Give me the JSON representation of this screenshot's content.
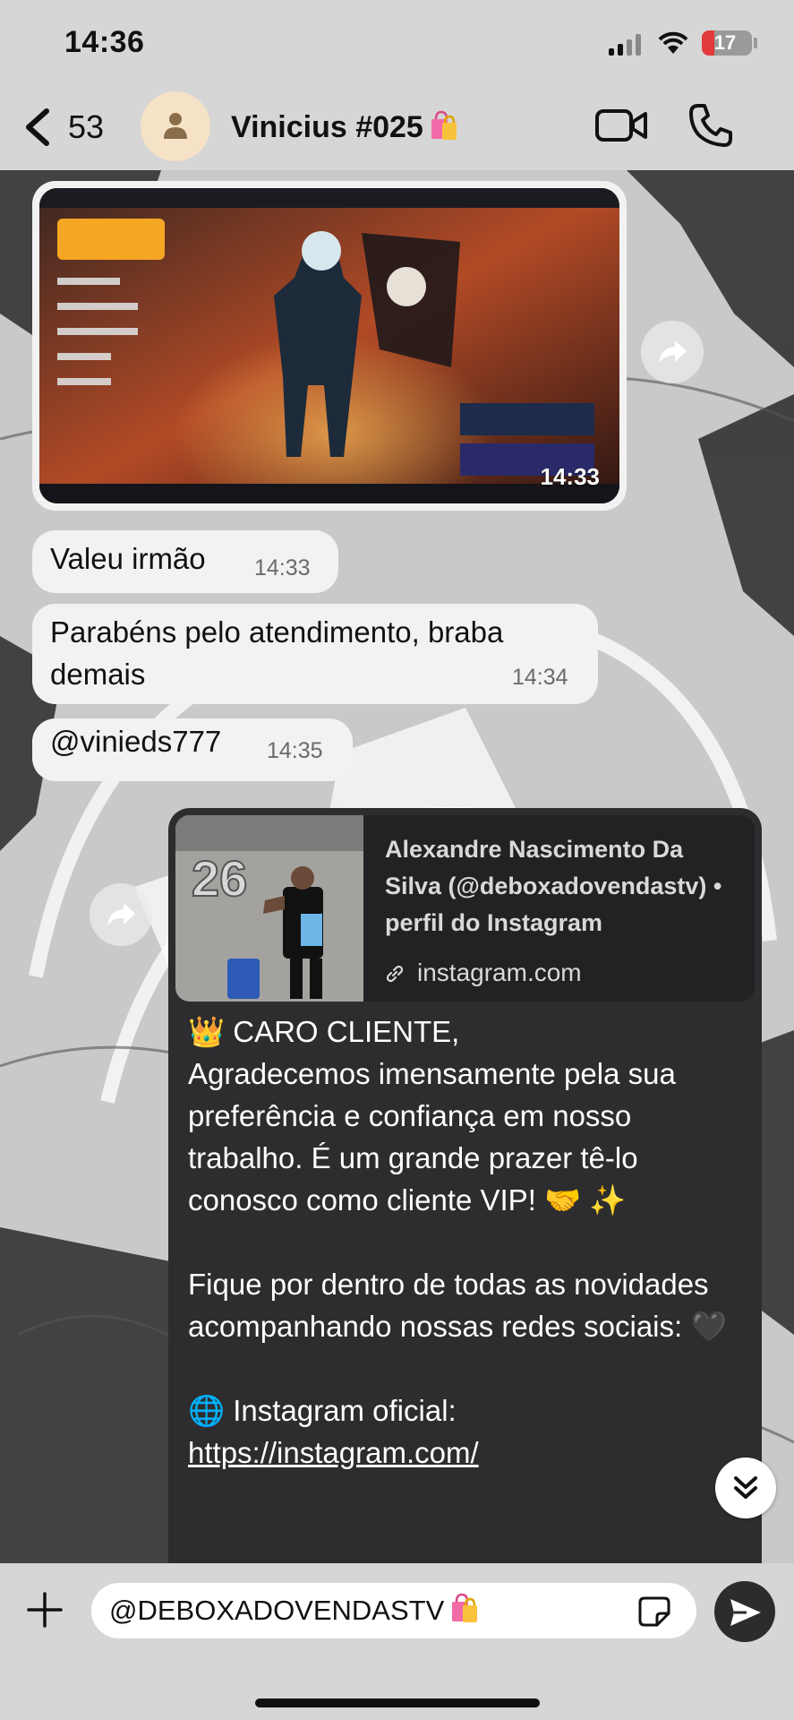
{
  "status_bar": {
    "time": "14:36",
    "battery": "17"
  },
  "header": {
    "back_count": "53",
    "contact_name": "Vinicius #025"
  },
  "messages": [
    {
      "text": "Valeu irmão",
      "time": "14:33"
    },
    {
      "text": "Parabéns pelo atendimento, braba demais",
      "time": "14:34"
    },
    {
      "text": "@vinieds777",
      "time": "14:35"
    }
  ],
  "image_message": {
    "time": "14:33"
  },
  "link_card": {
    "title": "Alexandre Nascimento Da Silva (@deboxadovendastv) • perfil do Instagram",
    "domain": "instagram.com",
    "body": "👑 CARO CLIENTE,\nAgradecemos imensamente pela sua preferência e confiança em nosso trabalho. É um grande prazer tê-lo conosco como cliente VIP! 🤝 ✨\n\nFique por dentro de todas as novidades acompanhando nossas redes sociais: 🖤\n\n🌐 Instagram oficial:",
    "link": "https://instagram.com/"
  },
  "composer": {
    "input_value": "@DEBOXADOVENDASTV"
  },
  "colors": {
    "incoming_bubble": "#f2f2f2",
    "outgoing_bubble": "#2d2d2f",
    "header_bg": "#d6d6d6",
    "avatar_bg": "#f6e2c6"
  }
}
